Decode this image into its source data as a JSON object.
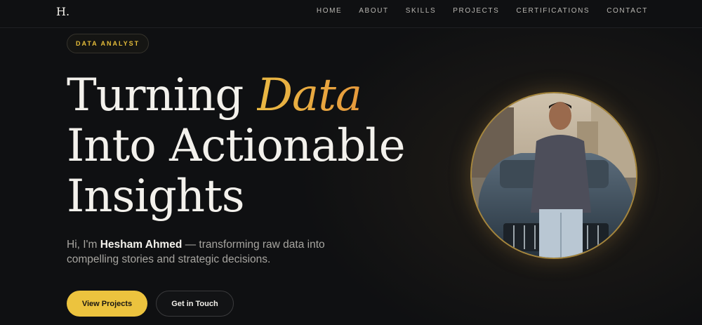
{
  "nav": {
    "logo": "H.",
    "links": [
      "HOME",
      "ABOUT",
      "SKILLS",
      "PROJECTS",
      "CERTIFICATIONS",
      "CONTACT"
    ]
  },
  "hero": {
    "badge": "DATA ANALYST",
    "headline_line1_prefix": "Turning ",
    "headline_line1_accent": "Data",
    "headline_line2": "Into Actionable",
    "headline_line3": "Insights",
    "intro_prefix": "Hi, I'm ",
    "intro_name": "Hesham Ahmed",
    "intro_suffix": " — transforming raw data into compelling stories and strategic decisions.",
    "primary_button": "View Projects",
    "secondary_button": "Get in Touch"
  },
  "colors": {
    "background": "#0f1012",
    "accent": "#ecc33e",
    "accent_gradient_end": "#e79a3c",
    "text": "#f3f1ec",
    "muted": "#a7a5a0"
  },
  "portrait": {
    "icon": "profile-photo"
  }
}
